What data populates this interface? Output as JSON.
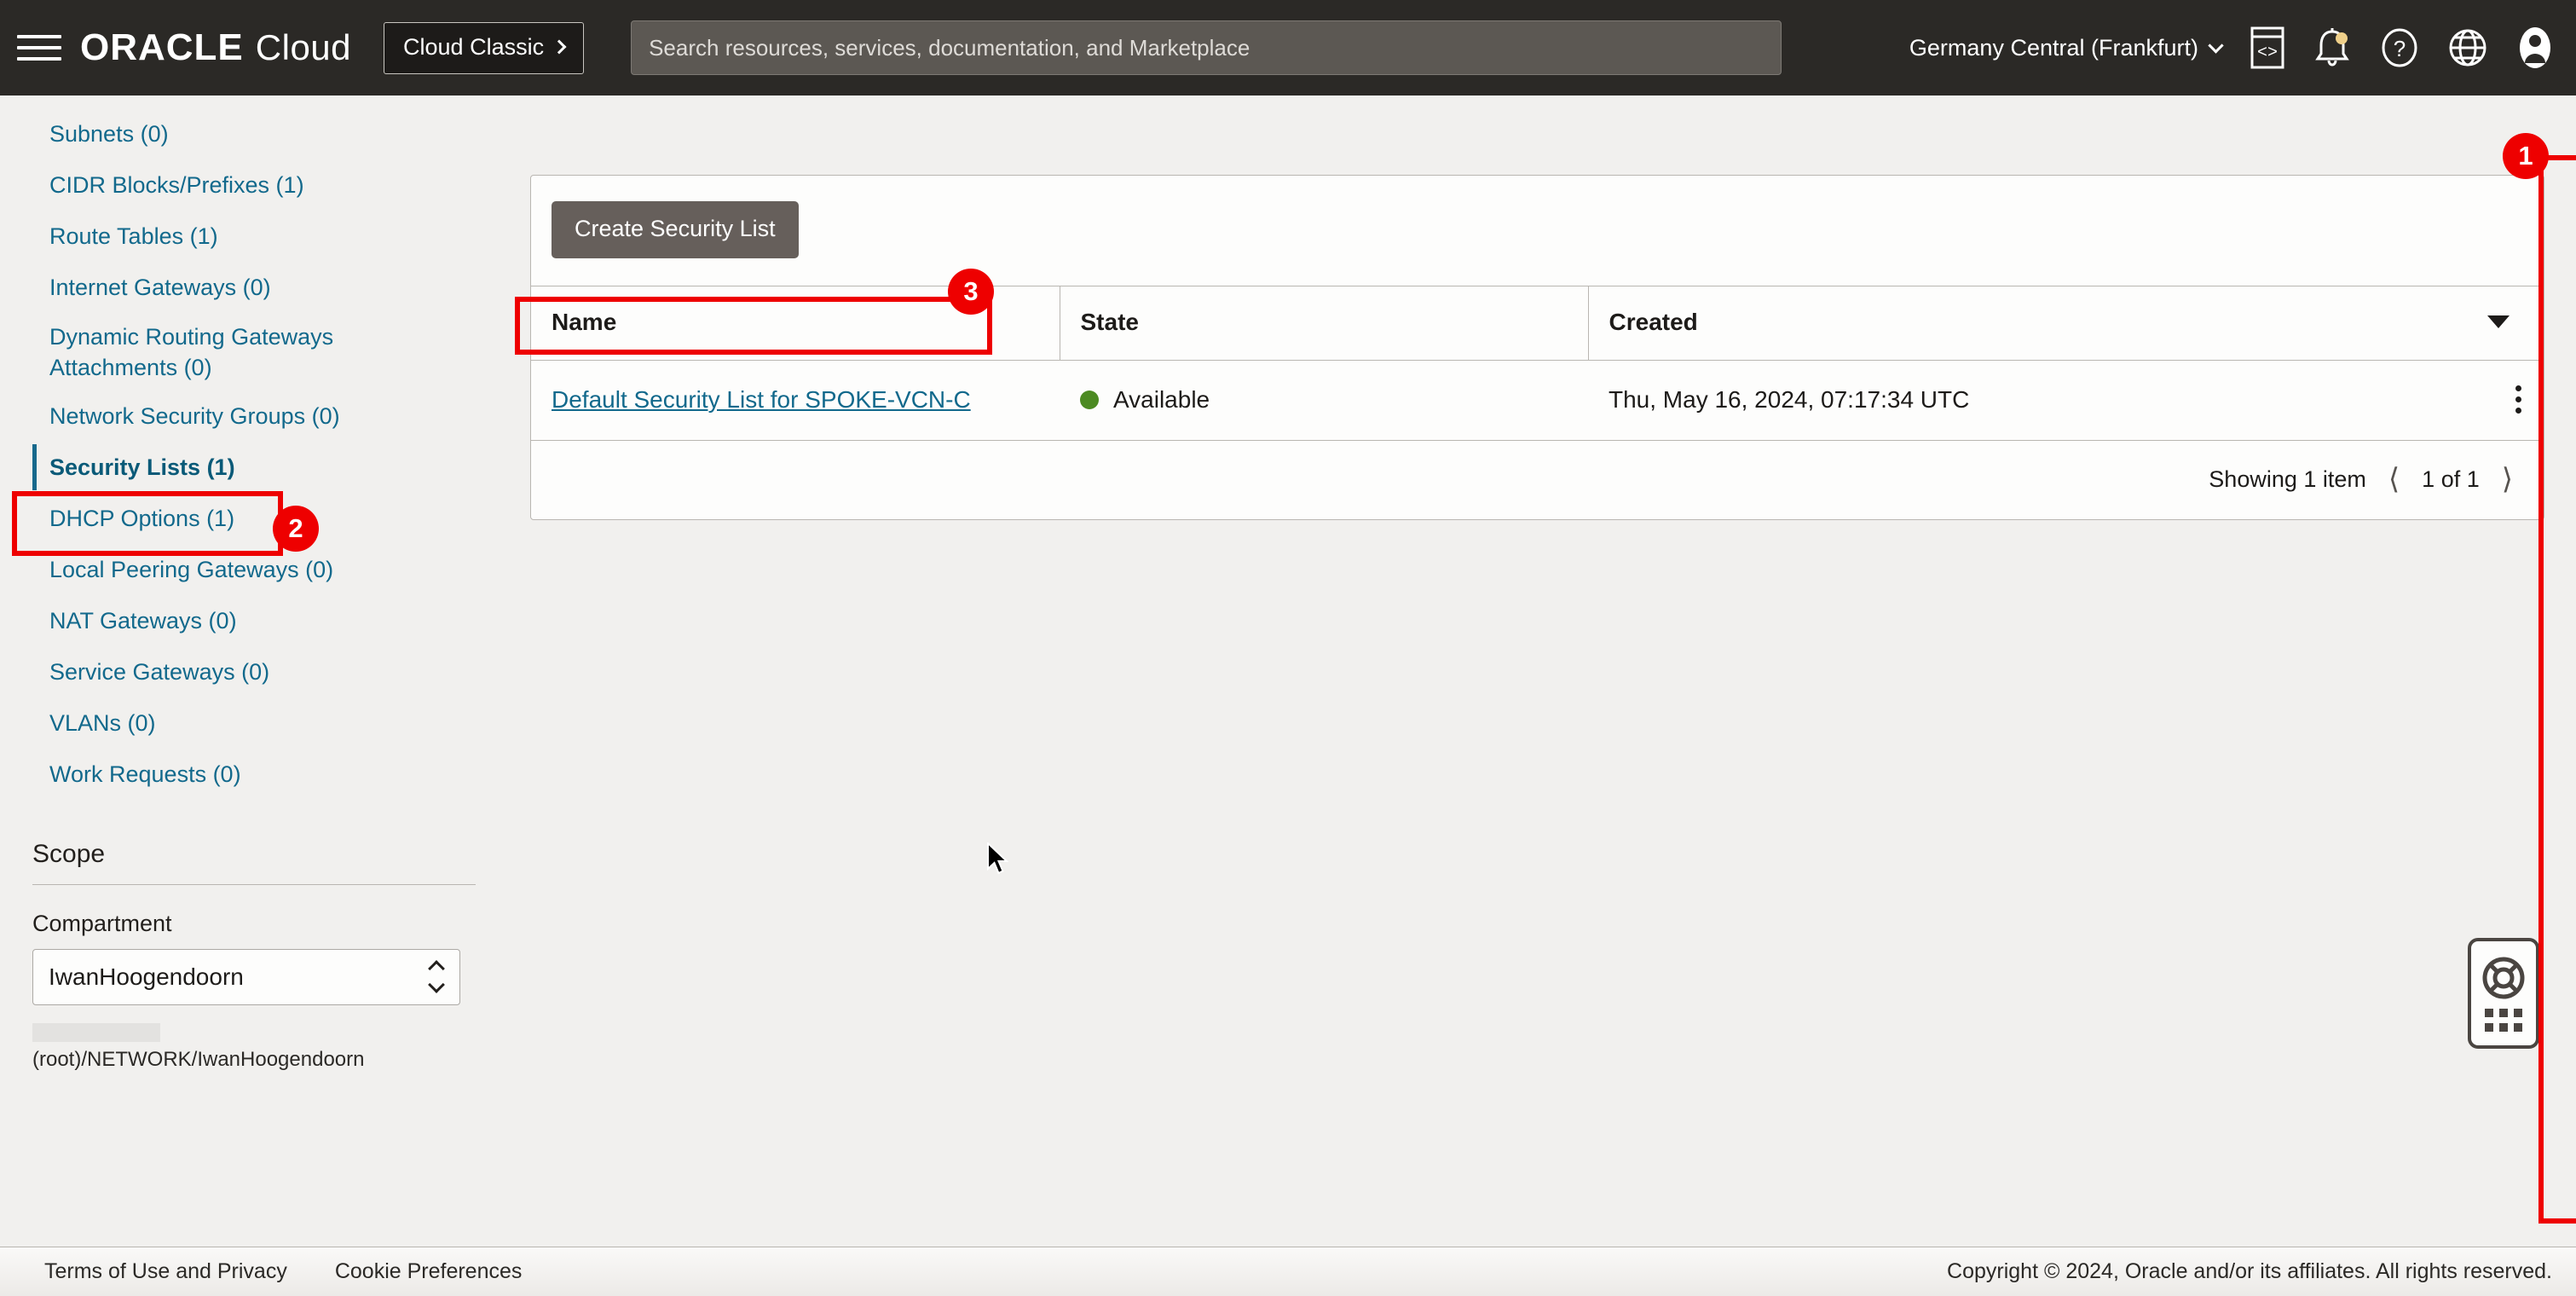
{
  "header": {
    "menu_icon": "hamburger-icon",
    "brand_oracle": "ORACLE",
    "brand_cloud": "Cloud",
    "cloud_classic_label": "Cloud Classic",
    "search_placeholder": "Search resources, services, documentation, and Marketplace",
    "search_value": "",
    "region": "Germany Central (Frankfurt)",
    "icons": [
      "cloud-shell-icon",
      "notifications-bell-icon",
      "help-question-icon",
      "language-globe-icon",
      "user-avatar-icon"
    ],
    "notification_dot_color": "#f0d08a"
  },
  "sidebar": {
    "items": [
      {
        "label": "Subnets (0)",
        "active": false
      },
      {
        "label": "CIDR Blocks/Prefixes (1)",
        "active": false
      },
      {
        "label": "Route Tables (1)",
        "active": false
      },
      {
        "label": "Internet Gateways (0)",
        "active": false
      },
      {
        "label": "Dynamic Routing Gateways Attachments (0)",
        "active": false
      },
      {
        "label": "Network Security Groups (0)",
        "active": false
      },
      {
        "label": "Security Lists (1)",
        "active": true
      },
      {
        "label": "DHCP Options (1)",
        "active": false
      },
      {
        "label": "Local Peering Gateways (0)",
        "active": false
      },
      {
        "label": "NAT Gateways (0)",
        "active": false
      },
      {
        "label": "Service Gateways (0)",
        "active": false
      },
      {
        "label": "VLANs (0)",
        "active": false
      },
      {
        "label": "Work Requests (0)",
        "active": false
      }
    ],
    "scope": {
      "title": "Scope",
      "compartment_label": "Compartment",
      "compartment_value": "IwanHoogendoorn",
      "compartment_path": "(root)/NETWORK/IwanHoogendoorn"
    }
  },
  "main": {
    "create_button_label": "Create Security List",
    "columns": [
      "Name",
      "State",
      "Created"
    ],
    "rows": [
      {
        "name": "Default Security List for SPOKE-VCN-C",
        "state": "Available",
        "state_color": "#4c8a22",
        "created": "Thu, May 16, 2024, 07:17:34 UTC"
      }
    ],
    "pagination": {
      "showing": "Showing 1 item",
      "page_label": "1 of 1",
      "prev_icon": "chevron-left-icon",
      "next_icon": "chevron-right-icon"
    }
  },
  "footer": {
    "terms_label": "Terms of Use and Privacy",
    "cookies_label": "Cookie Preferences",
    "copyright": "Copyright © 2024, Oracle and/or its affiliates. All rights reserved."
  },
  "help_widget": {
    "icon": "lifesaver-icon"
  },
  "annotations": [
    {
      "number": "1",
      "color": "#ee0000"
    },
    {
      "number": "2",
      "color": "#ee0000"
    },
    {
      "number": "3",
      "color": "#ee0000"
    }
  ]
}
